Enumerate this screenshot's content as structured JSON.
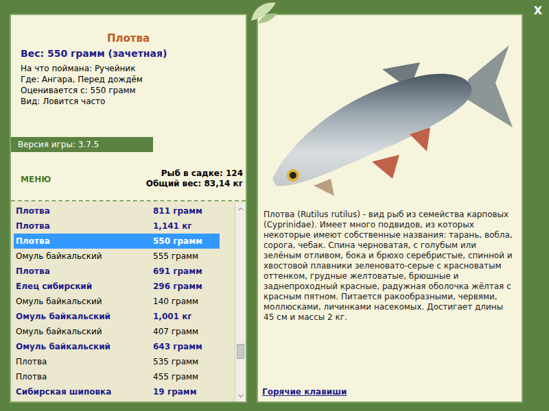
{
  "window": {
    "close": "X"
  },
  "fish_card": {
    "title": "Плотва",
    "weight": "Вес: 550 грамм (зачетная)",
    "details": [
      "На что поймана: Ручейник",
      "Где: Ангара, Перед дождём",
      "Оценивается с: 550 грамм",
      "Вид: Ловится часто"
    ]
  },
  "version": "Версия игры: 3.7.5",
  "menu": "МЕНЮ",
  "stats": [
    "Рыб в садке: 124",
    "Общий вес: 83,14 кг"
  ],
  "catch_list": [
    {
      "name": "Плотва",
      "weight": "811 грамм",
      "trophy": true,
      "selected": false
    },
    {
      "name": "Плотва",
      "weight": "1,141 кг",
      "trophy": true,
      "selected": false
    },
    {
      "name": "Плотва",
      "weight": "550 грамм",
      "trophy": true,
      "selected": true
    },
    {
      "name": "Омуль байкальский",
      "weight": "555 грамм",
      "trophy": false,
      "selected": false
    },
    {
      "name": "Плотва",
      "weight": "691 грамм",
      "trophy": true,
      "selected": false
    },
    {
      "name": "Елец сибирский",
      "weight": "296 грамм",
      "trophy": true,
      "selected": false
    },
    {
      "name": "Омуль байкальский",
      "weight": "140 грамм",
      "trophy": false,
      "selected": false
    },
    {
      "name": "Омуль байкальский",
      "weight": "1,001 кг",
      "trophy": true,
      "selected": false
    },
    {
      "name": "Омуль байкальский",
      "weight": "407 грамм",
      "trophy": false,
      "selected": false
    },
    {
      "name": "Омуль байкальский",
      "weight": "643 грамм",
      "trophy": true,
      "selected": false
    },
    {
      "name": "Плотва",
      "weight": "535 грамм",
      "trophy": false,
      "selected": false
    },
    {
      "name": "Плотва",
      "weight": "455 грамм",
      "trophy": false,
      "selected": false
    },
    {
      "name": "Сибирская шиповка",
      "weight": "19 грамм",
      "trophy": true,
      "selected": false
    }
  ],
  "scrollbar": {
    "level": 0.82
  },
  "description": "Плотва (Rutilus rutilus) - вид рыб из семейства карповых (Cyprinidae). Имеет много подвидов, из которых некоторые имеют собственные названия: тарань, вобла, сорога, чебак. Спина черноватая, с голубым или зелёным отливом, бока и брюхо серебристые, спинной и хвостовой плавники зеленовато-серые с красноватым оттенком, грудные желтоватые, брюшные и заднепроходный красные, радужная оболочка жёлтая с красным пятном. Питается ракообразными, червями, моллюсками, личинками насекомых. Достигает длины 45 см и массы 2 кг.",
  "hotkeys": "Горячие клавиши"
}
